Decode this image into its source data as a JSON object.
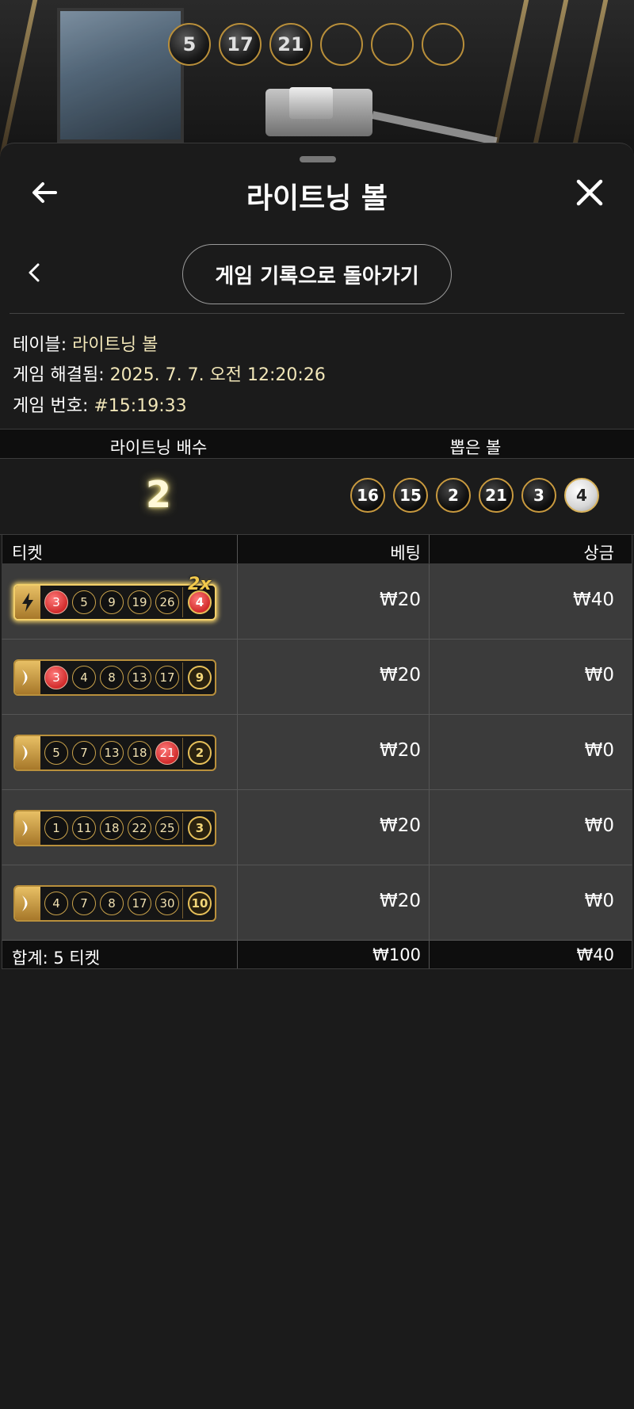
{
  "top_balls": [
    "5",
    "17",
    "21",
    "",
    "",
    ""
  ],
  "header": {
    "title": "라이트닝 볼",
    "back_icon": "arrow-left-icon",
    "close_icon": "close-icon"
  },
  "nav": {
    "history_button": "게임 기록으로 돌아가기"
  },
  "info": {
    "table_label": "테이블:",
    "table_value": "라이트닝 볼",
    "resolved_label": "게임 해결됨:",
    "resolved_value": "2025. 7. 7. 오전 12:20:26",
    "game_no_label": "게임 번호:",
    "game_no_value": "#15:19:33"
  },
  "summary": {
    "col_multiplier": "라이트닝 배수",
    "col_drawn": "뽑은 볼",
    "multiplier": "2",
    "drawn_balls": [
      "16",
      "15",
      "2",
      "21",
      "3",
      "4"
    ]
  },
  "table": {
    "headers": {
      "ticket": "티켓",
      "bet": "베팅",
      "prize": "상금"
    },
    "rows": [
      {
        "type": "lightning",
        "badge": "2x",
        "numbers": [
          "3",
          "5",
          "9",
          "19",
          "26"
        ],
        "hits": [
          true,
          false,
          false,
          false,
          false
        ],
        "bonus": "4",
        "bonus_hit": true,
        "bet": "₩20",
        "prize": "₩40"
      },
      {
        "type": "normal",
        "badge": "",
        "numbers": [
          "3",
          "4",
          "8",
          "13",
          "17"
        ],
        "hits": [
          true,
          false,
          false,
          false,
          false
        ],
        "bonus": "9",
        "bonus_hit": false,
        "bet": "₩20",
        "prize": "₩0"
      },
      {
        "type": "normal",
        "badge": "",
        "numbers": [
          "5",
          "7",
          "13",
          "18",
          "21"
        ],
        "hits": [
          false,
          false,
          false,
          false,
          true
        ],
        "bonus": "2",
        "bonus_hit": false,
        "bet": "₩20",
        "prize": "₩0"
      },
      {
        "type": "normal",
        "badge": "",
        "numbers": [
          "1",
          "11",
          "18",
          "22",
          "25"
        ],
        "hits": [
          false,
          false,
          false,
          false,
          false
        ],
        "bonus": "3",
        "bonus_hit": false,
        "bet": "₩20",
        "prize": "₩0"
      },
      {
        "type": "normal",
        "badge": "",
        "numbers": [
          "4",
          "7",
          "8",
          "17",
          "30"
        ],
        "hits": [
          false,
          false,
          false,
          false,
          false
        ],
        "bonus": "10",
        "bonus_hit": false,
        "bet": "₩20",
        "prize": "₩0"
      }
    ],
    "footer": {
      "total_label": "합계: 5 티켓",
      "total_bet": "₩100",
      "total_prize": "₩40"
    }
  },
  "colors": {
    "accent_gold": "#c9a24b",
    "hit_red": "#d12b2b",
    "info_value": "#f1e6b8"
  }
}
